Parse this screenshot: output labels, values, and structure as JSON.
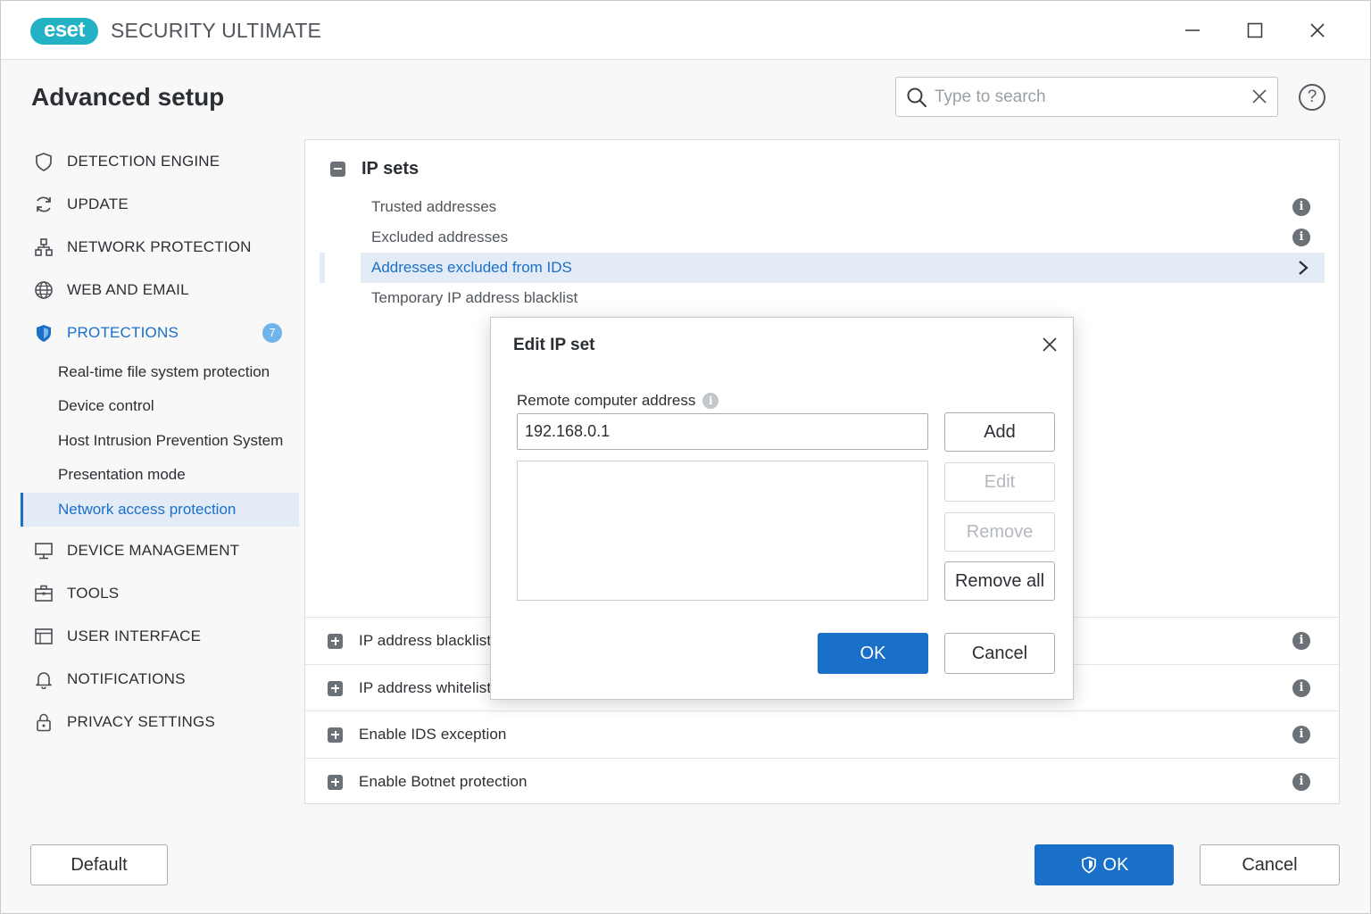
{
  "app": {
    "logo_text": "eset",
    "title": "SECURITY ULTIMATE"
  },
  "window_controls": {
    "minimize": "minimize-icon",
    "maximize": "maximize-icon",
    "close": "close-icon"
  },
  "header": {
    "page_title": "Advanced setup",
    "search_placeholder": "Type to search",
    "search_value": "",
    "help_glyph": "?"
  },
  "sidebar": {
    "items": [
      {
        "label": "DETECTION ENGINE",
        "icon": "shield-outline-icon"
      },
      {
        "label": "UPDATE",
        "icon": "refresh-icon"
      },
      {
        "label": "NETWORK PROTECTION",
        "icon": "network-icon"
      },
      {
        "label": "WEB AND EMAIL",
        "icon": "globe-icon"
      },
      {
        "label": "PROTECTIONS",
        "icon": "shield-filled-icon",
        "badge": "7",
        "active": true
      },
      {
        "label": "DEVICE MANAGEMENT",
        "icon": "monitor-icon"
      },
      {
        "label": "TOOLS",
        "icon": "toolbox-icon"
      },
      {
        "label": "USER INTERFACE",
        "icon": "window-icon"
      },
      {
        "label": "NOTIFICATIONS",
        "icon": "bell-icon"
      },
      {
        "label": "PRIVACY SETTINGS",
        "icon": "lock-icon"
      }
    ],
    "sub_items": [
      {
        "label": "Real-time file system protection"
      },
      {
        "label": "Device control"
      },
      {
        "label": "Host Intrusion Prevention System"
      },
      {
        "label": "Presentation mode"
      },
      {
        "label": "Network access protection",
        "selected": true
      }
    ]
  },
  "content": {
    "ip_sets": {
      "title": "IP sets",
      "rows": [
        {
          "label": "Trusted addresses"
        },
        {
          "label": "Excluded addresses"
        },
        {
          "label": "Addresses excluded from IDS",
          "highlight": true
        },
        {
          "label": "Temporary IP address blacklist"
        }
      ]
    },
    "collapsed_sections": [
      {
        "label": "IP address blacklist"
      },
      {
        "label": "IP address whitelist"
      },
      {
        "label": "Enable IDS exception"
      },
      {
        "label": "Enable Botnet protection"
      }
    ]
  },
  "dialog": {
    "title": "Edit IP set",
    "field_label": "Remote computer address",
    "address_value": "192.168.0.1",
    "buttons": {
      "add": "Add",
      "edit": "Edit",
      "remove": "Remove",
      "remove_all": "Remove all",
      "ok": "OK",
      "cancel": "Cancel"
    }
  },
  "footer": {
    "default": "Default",
    "ok": "OK",
    "cancel": "Cancel"
  },
  "colors": {
    "accent": "#1a6fc9",
    "logo": "#23b2c4",
    "highlight_bg": "#e3ecf6",
    "badge": "#6fb4ea"
  }
}
